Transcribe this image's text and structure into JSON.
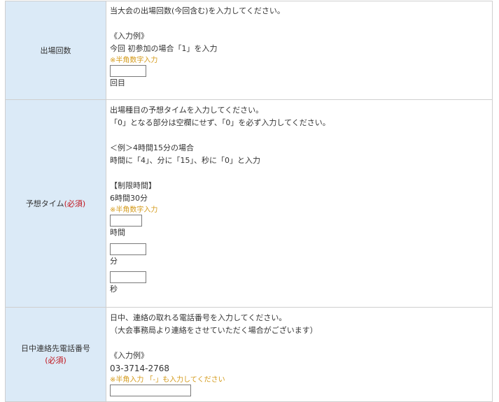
{
  "row1": {
    "label": "出場回数",
    "lines": [
      "当大会の出場回数(今回含む)を入力してください。",
      "《入力例》",
      "今回 初参加の場合「1」を入力"
    ],
    "note": "※半角数字入力",
    "value": "",
    "unit": "回目"
  },
  "row2": {
    "label": "予想タイム",
    "required": "(必須)",
    "lines": [
      "出場種目の予想タイムを入力してください。",
      "「0」となる部分は空欄にせず、「0」を必ず入力してください。",
      "＜例＞4時間15分の場合",
      "時間に「4」、分に「15」、秒に「0」と入力",
      "【制限時間】",
      "6時間30分"
    ],
    "note": "※半角数字入力",
    "hours_value": "",
    "hours_unit": "時間",
    "minutes_value": "",
    "minutes_unit": "分",
    "seconds_value": "",
    "seconds_unit": "秒"
  },
  "row3": {
    "label": "日中連絡先電話番号",
    "required": "(必須)",
    "lines": [
      "日中、連絡の取れる電話番号を入力してください。",
      "（大会事務局より連絡をさせていただく場合がございます）",
      "《入力例》",
      "03-3714-2768"
    ],
    "note": "※半角入力 「-」も入力してください",
    "value": ""
  }
}
